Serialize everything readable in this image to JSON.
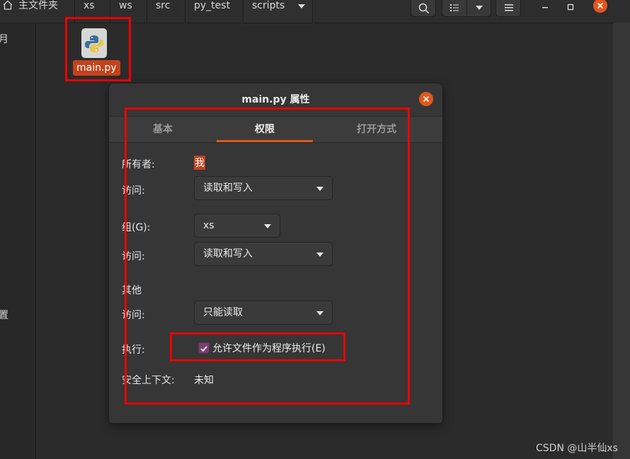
{
  "breadcrumbs": [
    "主文件夹",
    "xs",
    "ws",
    "src",
    "py_test",
    "scripts"
  ],
  "sidebar": {
    "partial_labels": [
      "月",
      "置"
    ]
  },
  "file": {
    "name": "main.py"
  },
  "dialog": {
    "title": "main.py 属性",
    "tabs": [
      {
        "label": "基本",
        "active": false
      },
      {
        "label": "权限",
        "active": true
      },
      {
        "label": "打开方式",
        "active": false
      }
    ],
    "owner": {
      "label": "所有者:",
      "value": "我"
    },
    "owner_access": {
      "label": "访问:",
      "value": "读取和写入"
    },
    "group": {
      "label": "组(G):",
      "value": "xs"
    },
    "group_access": {
      "label": "访问:",
      "value": "读取和写入"
    },
    "others": {
      "heading": "其他"
    },
    "others_access": {
      "label": "访问:",
      "value": "只能读取"
    },
    "execute": {
      "label": "执行:",
      "checkbox_label": "允许文件作为程序执行(E)",
      "checked": true
    },
    "security_context": {
      "label": "安全上下文:",
      "value": "未知"
    }
  },
  "watermark": "CSDN @山半仙xs",
  "colors": {
    "accent": "#e2571e",
    "selection": "#c1431d",
    "checkbox": "#7a3d6e",
    "annotation": "#ee0000"
  }
}
